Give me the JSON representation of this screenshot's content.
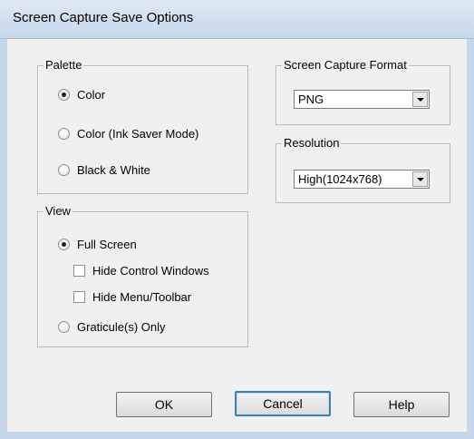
{
  "window": {
    "title": "Screen Capture Save Options"
  },
  "palette": {
    "label": "Palette",
    "options": [
      {
        "label": "Color",
        "selected": true
      },
      {
        "label": "Color (Ink Saver Mode)",
        "selected": false
      },
      {
        "label": "Black & White",
        "selected": false
      }
    ]
  },
  "format": {
    "label": "Screen Capture Format",
    "value": "PNG"
  },
  "resolution": {
    "label": "Resolution",
    "value": "High(1024x768)"
  },
  "view": {
    "label": "View",
    "full_screen": {
      "label": "Full Screen",
      "selected": true
    },
    "hide_control_windows": {
      "label": "Hide Control Windows",
      "checked": false
    },
    "hide_menu_toolbar": {
      "label": "Hide Menu/Toolbar",
      "checked": false
    },
    "graticule_only": {
      "label": "Graticule(s) Only",
      "selected": false
    }
  },
  "buttons": {
    "ok": "OK",
    "cancel": "Cancel",
    "help": "Help"
  }
}
